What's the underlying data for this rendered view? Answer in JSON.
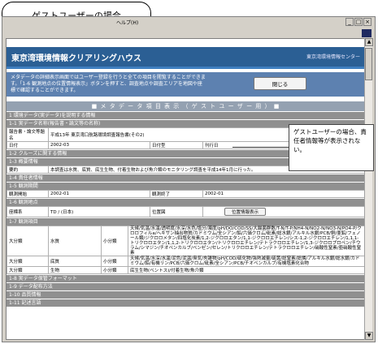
{
  "window": {
    "menu": "ヘルプ(H)",
    "btn_min": "_",
    "btn_max": "□",
    "btn_close": "×"
  },
  "callouts": {
    "top": "ゲストユーザーの場合",
    "right": "ゲストユーザーの場合、責任者情報等が表示されない。"
  },
  "banner": {
    "title": "東京湾環境情報クリアリングハウス",
    "logo": "東京湾環境情報センター"
  },
  "notice": {
    "text": "メタデータの詳細表示画面ではユーザー登録を行うと全ての項目を閲覧することができます。「1-6 観測地点の位置情報表示」ボタンを押すと、調査地点や調査エリアを地図や座標で確認することができます。",
    "close_label": "閉じる"
  },
  "section_title": "■ メ タ デ ー タ 項 目 表 示 （ ゲ ス ト ユ ー ザ ー 用 ） ■",
  "sections": {
    "s1": "1 環境データ(実データ)を説明する情報",
    "s1_1": "1-1 実データ名称(報告書・論文等の名称)",
    "s1_2": "1-2 クルーズに関する情報",
    "s1_3": "1-3 概要情報",
    "s1_4": "1-4 責任者情報",
    "s1_5": "1-5 観測期間",
    "s1_6": "1-6 観測地点",
    "s1_7": "1-7 観測項目",
    "s1_8": "1-8 実データ保管フォーマット",
    "s1_9": "1-9 データ配布方法",
    "s1_10": "1-10 品質情報",
    "s1_11": "1-11 記述言語"
  },
  "rows": {
    "report_label": "報告書・論文等題名",
    "report_value": "平成13年 東京湾口航路環境調査報告書(その2)",
    "date_label": "日付",
    "date_value": "2002-03",
    "date_type_label": "日付型",
    "date_type_value": "刊行日",
    "summary_label": "要約",
    "summary_value": "本調査は水質、底質、底生生物、付着生物および魚介類のモニタリング調査を平成14年1月に行った。",
    "start_label": "観測開始",
    "start_value": "2002-01",
    "end_label": "観測終了",
    "end_value": "2002-01",
    "coord_label": "座標系",
    "coord_value": "TD / (日本)",
    "pos_label": "位置図",
    "pos_button": "位置情報表示"
  },
  "items": [
    {
      "major_label": "大分類",
      "major": "水質",
      "minor_label": "小分類",
      "minor": "天候/気温/水温/透明度/水深/水色/塩分/濁度/pH/DO/COD/SS/大腸菌群数/T-N/T-P/NH4-N/NO2-N/NO3-N/PO4-P/クロロフィルa/ヘキサン抽出物質/カドミウム/全シアン/鉛/六価クロム/砒素/総水銀/アルキル水銀/PCB/銅/亜鉛/フェノール類/ジクロロメタン/四塩化炭素/1,2-ジクロロエタン/1,1-ジクロロエチレン/シス-1,2-ジクロロエチレン/1,1,1-トリクロロエタン/1,1,2-トリクロロエタン/トリクロロエチレン/テトラクロロエチレン/1,3-ジクロロプロペン/チウラム/シマジン/チオベンカルブ/ベンゼン/セレン/トリクロロエチレン/テトラクロロエチレン/硝酸性窒素/亜硝酸性窒素"
    },
    {
      "major_label": "大分類",
      "major": "底質",
      "minor_label": "小分類",
      "minor": "天候/気温/水深/水温/泥色/泥温/臭気/夾雑物/pH/COD/硫化物/強熱減量/硫黄/総窒素/総燐/アルキル水銀/総水銀/カドミウム/鉛/有機リン/PCB/六価クロム/砒素/全シアン/PCB/チオベンカルブ/有機塩素化合物"
    },
    {
      "major_label": "大分類",
      "major": "生物",
      "minor_label": "小分類",
      "minor": "底生生物(ベントス)/付着生物/魚介類"
    }
  ]
}
